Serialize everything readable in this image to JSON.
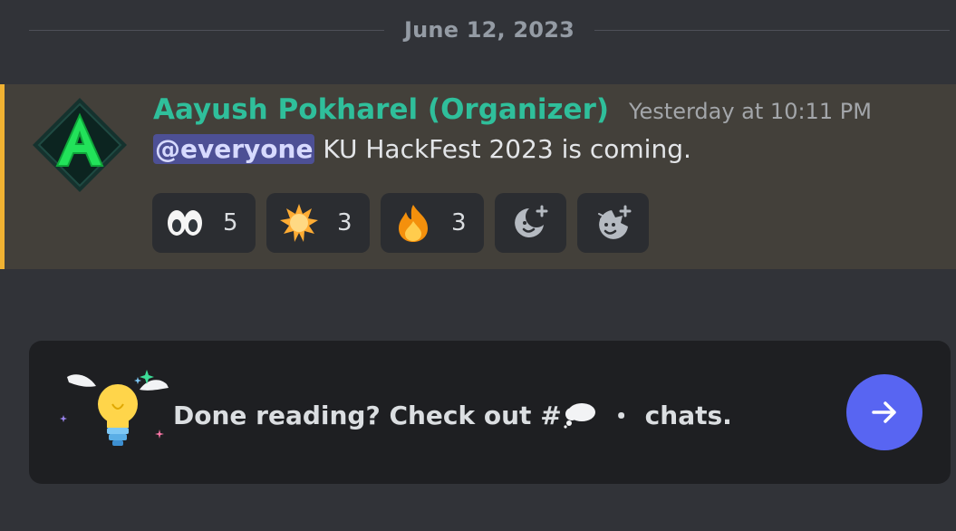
{
  "divider": {
    "date": "June 12, 2023"
  },
  "message": {
    "author": "Aayush Pokharel (Organizer)",
    "timestamp": "Yesterday at 10:11 PM",
    "mention": "@everyone",
    "text": " KU HackFest 2023 is coming.",
    "reactions": [
      {
        "emoji": "eyes-emoji",
        "count": "5"
      },
      {
        "emoji": "sun-emoji",
        "count": "3"
      },
      {
        "emoji": "fire-emoji",
        "count": "3"
      }
    ],
    "add_reaction_icons": [
      "add-reaction-icon",
      "add-super-reaction-icon"
    ]
  },
  "banner": {
    "prefix": "Done reading? Check out #",
    "channel_icon": "thought-balloon-emoji",
    "separator": "・",
    "suffix": "chats."
  },
  "colors": {
    "background": "#313338",
    "highlight": "#43403a",
    "highlight_border": "#f0b232",
    "author": "#2fbf9b",
    "mention_bg": "#4d5095",
    "button": "#5865f2"
  }
}
